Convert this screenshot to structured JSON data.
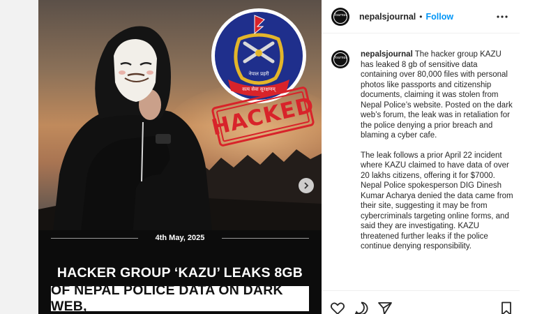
{
  "post": {
    "username": "nepalsjournal",
    "separator": "•",
    "follow_label": "Follow",
    "avatar_text": "Journal",
    "more_icon": "more-horizontal-icon"
  },
  "image": {
    "police_emblem_text_top": "नेपाल प्रहरी",
    "police_emblem_text_motto": "सत्य सेवा सुरक्षणम्",
    "stamp_text": "HACKED",
    "date": "4th  May, 2025",
    "headline_line1": "HACKER GROUP ‘KAZU’ LEAKS 8GB",
    "headline_line2": "OF NEPAL POLICE DATA ON DARK WEB,",
    "carousel_icon": "chevron-right-icon"
  },
  "caption": {
    "username": "nepalsjournal",
    "paragraph1": "The hacker group KAZU has leaked 8 gb of sensitive data containing over 80,000 files with personal photos like passports and citizenship documents, claiming it was stolen from Nepal Police’s website. Posted on the dark web’s forum, the leak was in retaliation for the police denying a prior breach and blaming a cyber cafe.",
    "paragraph2": "The leak follows a prior April 22 incident where KAZU claimed to have data of over 20 lakhs citizens, offering it for $7000. Nepal Police spokesperson DIG Dinesh Kumar Acharya denied the data came from their site, suggesting it may be from cybercriminals targeting online forms, and said they are investigating. KAZU threatened further leaks if the police continue denying responsibility."
  },
  "actions": {
    "icons": [
      "heart-icon",
      "comment-icon",
      "share-icon",
      "bookmark-icon"
    ]
  },
  "colors": {
    "follow_blue": "#0095f6",
    "stamp_red": "#d8232a",
    "emblem_blue": "#1f2f8c"
  }
}
